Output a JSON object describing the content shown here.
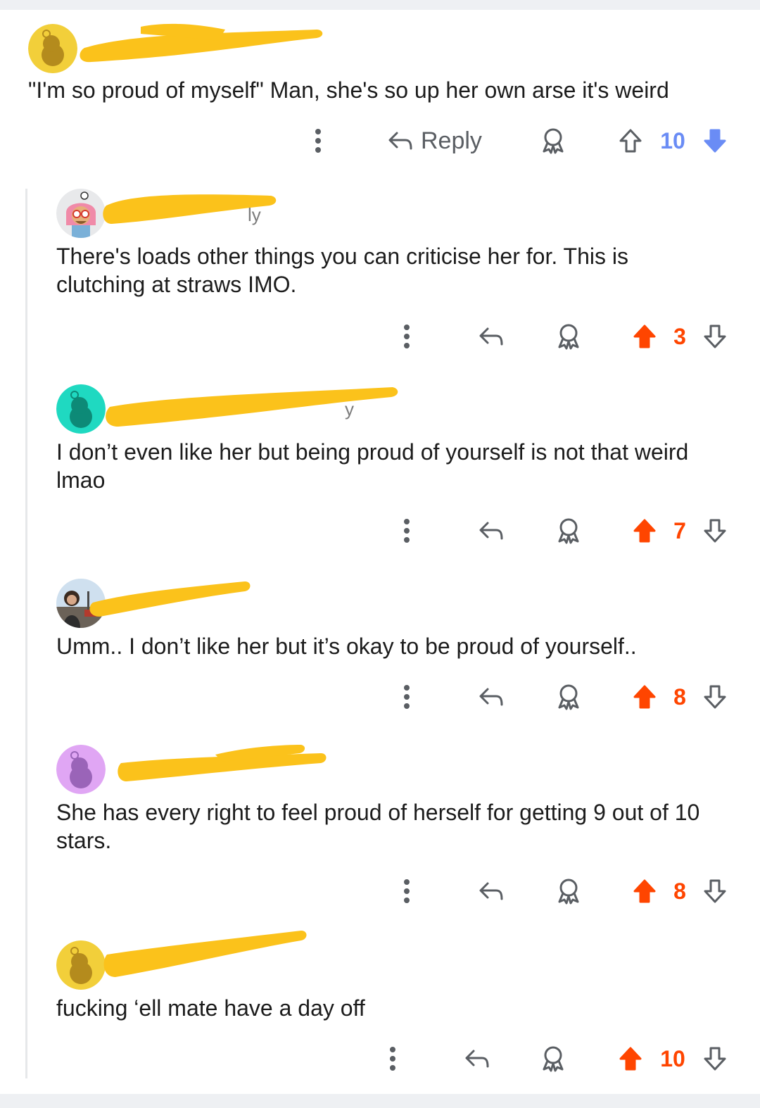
{
  "comments": [
    {
      "id": "c1",
      "username": "",
      "text": "\"I'm so proud of myself\" Man, she's so up her own arse it's weird",
      "score": "10",
      "vote": "down",
      "reply_label": "Reply",
      "avatar": "yellow-snoo"
    },
    {
      "id": "c2",
      "username": "ly",
      "text": "There's loads other things you can criticise her for. This is clutching at straws IMO.",
      "score": "3",
      "vote": "up",
      "avatar": "pink-custom"
    },
    {
      "id": "c3",
      "username": "y",
      "text": "I don’t even like her but being proud of yourself is not that weird lmao",
      "score": "7",
      "vote": "up",
      "avatar": "teal-snoo"
    },
    {
      "id": "c4",
      "username": "",
      "text": "Umm.. I don’t like her but it’s okay to be proud of yourself..",
      "score": "8",
      "vote": "up",
      "avatar": "photo"
    },
    {
      "id": "c5",
      "username": "",
      "text": "She has every right to feel proud of herself for getting 9 out of 10 stars.",
      "score": "8",
      "vote": "up",
      "avatar": "purple-snoo"
    },
    {
      "id": "c6",
      "username": "",
      "text": "fucking ‘ell mate have a day off",
      "score": "10",
      "vote": "up",
      "avatar": "yellow-snoo"
    }
  ],
  "icons": [
    "overflow-menu-icon",
    "reply-arrow-icon",
    "award-icon",
    "upvote-arrow-icon",
    "downvote-arrow-icon"
  ],
  "colors": {
    "upvote": "#ff4500",
    "downvote": "#6a8cf5",
    "redaction": "#fbc21b",
    "text": "#1c1c1c",
    "muted": "#5a5e63"
  }
}
